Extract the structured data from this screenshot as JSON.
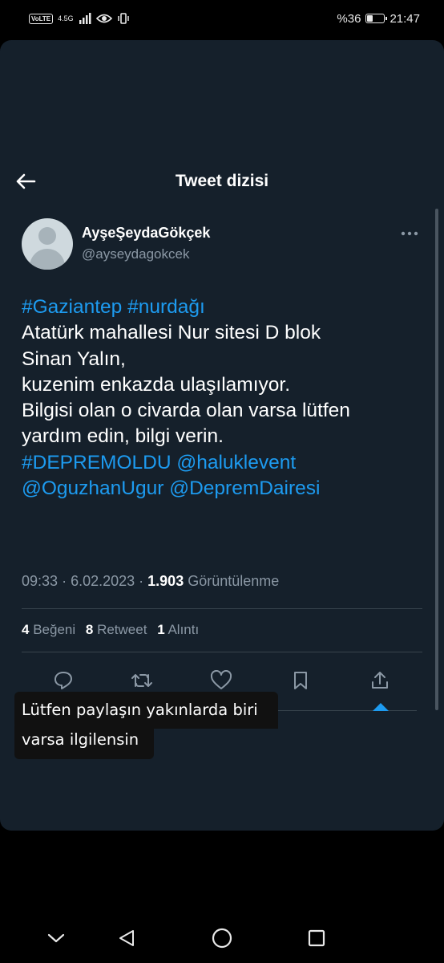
{
  "status_bar": {
    "volte": "VoLTE",
    "network": "4.5G",
    "battery_text": "%36",
    "battery_level": 0.36,
    "time": "21:47"
  },
  "header": {
    "title": "Tweet dizisi",
    "back_icon": "arrow-left-icon"
  },
  "tweet": {
    "author_name": "AyşeŞeydaGökçek",
    "author_handle": "@ayseydagokcek",
    "more_icon": "more-horizontal-icon",
    "lines": [
      [
        {
          "text": "#Gaziantep #nurdağı",
          "link": true
        }
      ],
      [
        {
          "text": "Atatürk mahallesi Nur sitesi D blok",
          "link": false
        }
      ],
      [
        {
          "text": "Sinan Yalın,",
          "link": false
        }
      ],
      [
        {
          "text": "kuzenim enkazda ulaşılamıyor.",
          "link": false
        }
      ],
      [
        {
          "text": "Bilgisi olan o civarda olan varsa lütfen",
          "link": false
        }
      ],
      [
        {
          "text": "yardım edin, bilgi verin.",
          "link": false
        }
      ],
      [
        {
          "text": "#DEPREMOLDU @haluklevent",
          "link": true
        }
      ],
      [
        {
          "text": "@OguzhanUgur @DepremDairesi",
          "link": true
        }
      ]
    ],
    "time": "09:33",
    "date": "6.02.2023",
    "views_count": "1.903",
    "views_label": "Görüntülenme",
    "likes_count": "4",
    "likes_label": "Beğeni",
    "retweets_count": "8",
    "retweets_label": "Retweet",
    "quotes_count": "1",
    "quotes_label": "Alıntı"
  },
  "actions": [
    {
      "name": "reply-button",
      "icon": "reply-icon"
    },
    {
      "name": "retweet-button",
      "icon": "retweet-icon"
    },
    {
      "name": "like-button",
      "icon": "heart-icon"
    },
    {
      "name": "bookmark-button",
      "icon": "bookmark-icon"
    },
    {
      "name": "share-button",
      "icon": "share-icon"
    }
  ],
  "overlay": {
    "line1": "Lütfen paylaşın yakınlarda biri",
    "line2": "varsa ilgilensin"
  },
  "navigation": {
    "collapse_icon": "chevron-down-icon",
    "back_icon": "triangle-back-icon",
    "home_icon": "circle-home-icon",
    "recents_icon": "square-recents-icon"
  },
  "colors": {
    "background": "#15202b",
    "link": "#1d9bf0",
    "secondary_text": "#8b98a5",
    "divider": "#38444d"
  }
}
